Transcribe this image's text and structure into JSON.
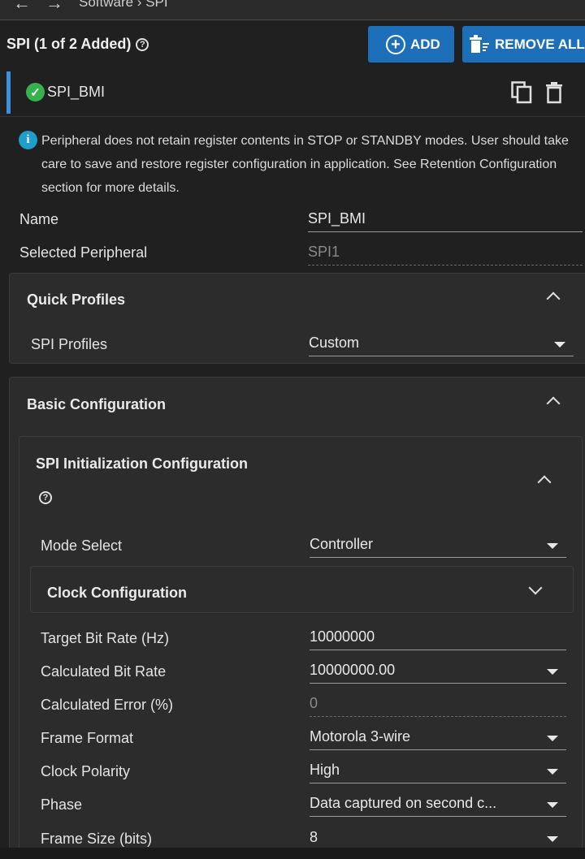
{
  "nav": {
    "breadcrumb": "Software  ›  SPI"
  },
  "header": {
    "title": "SPI (1 of 2 Added)",
    "add_label": "ADD",
    "remove_all_label": "REMOVE ALL"
  },
  "instance": {
    "name": "SPI_BMI"
  },
  "info": {
    "message": "Peripheral does not retain register contents in STOP or STANDBY modes. User should take care to save and restore register configuration in application. See Retention Configuration section for more details."
  },
  "general": {
    "name_label": "Name",
    "name_value": "SPI_BMI",
    "peripheral_label": "Selected Peripheral",
    "peripheral_value": "SPI1"
  },
  "quick_profiles": {
    "title": "Quick Profiles",
    "profiles_label": "SPI Profiles",
    "profiles_value": "Custom"
  },
  "basic_config": {
    "title": "Basic Configuration"
  },
  "init_config": {
    "title": "SPI Initialization Configuration",
    "mode_label": "Mode Select",
    "mode_value": "Controller",
    "clock_section_title": "Clock Configuration",
    "fields": [
      {
        "label": "Target Bit Rate (Hz)",
        "value": "10000000"
      },
      {
        "label": "Calculated Bit Rate",
        "value": "10000000.00"
      },
      {
        "label": "Calculated Error (%)",
        "value": "0"
      },
      {
        "label": "Frame Format",
        "value": "Motorola 3-wire"
      },
      {
        "label": "Clock Polarity",
        "value": "High"
      },
      {
        "label": "Phase",
        "value": "Data captured on second c..."
      },
      {
        "label": "Frame Size (bits)",
        "value": "8"
      }
    ]
  },
  "colors": {
    "accent": "#1c6fb8",
    "success": "#37b04e",
    "info": "#1e9ec9",
    "background": "#202020"
  }
}
